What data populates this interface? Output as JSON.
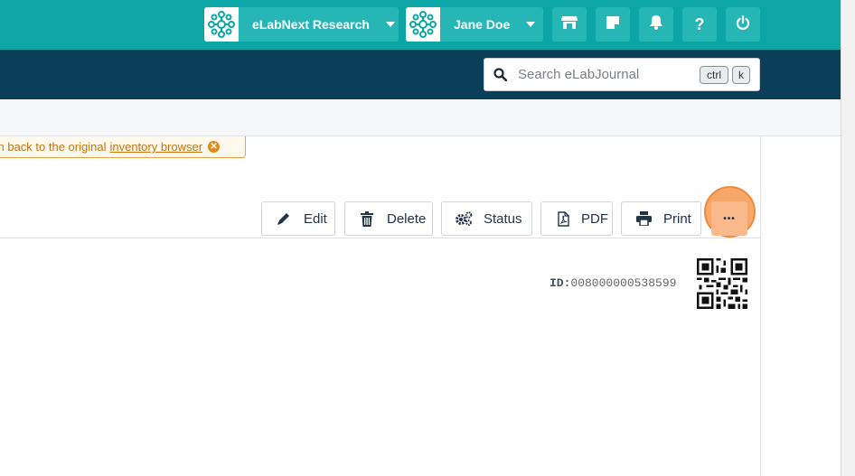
{
  "header": {
    "workspace_label": "eLabNext Research",
    "user_label": "Jane Doe",
    "icons": [
      "store-icon",
      "notes-icon",
      "bell-icon",
      "help-icon",
      "power-icon"
    ],
    "help_glyph": "?"
  },
  "search": {
    "placeholder": "Search eLabJournal",
    "shortcut_key1": "ctrl",
    "shortcut_key2": "k"
  },
  "notice": {
    "text": "ch back to the original",
    "link_text": "inventory browser"
  },
  "toolbar": {
    "edit_label": "Edit",
    "delete_label": "Delete",
    "status_label": "Status",
    "pdf_label": "PDF",
    "print_label": "Print",
    "more_label": "•••"
  },
  "item": {
    "id_label": "ID:",
    "id_value": "008000000538599"
  },
  "colors": {
    "teal": "#0da6a6",
    "navy": "#0b3f59",
    "highlight": "#f7a868",
    "notice_orange": "#e08b1e"
  }
}
